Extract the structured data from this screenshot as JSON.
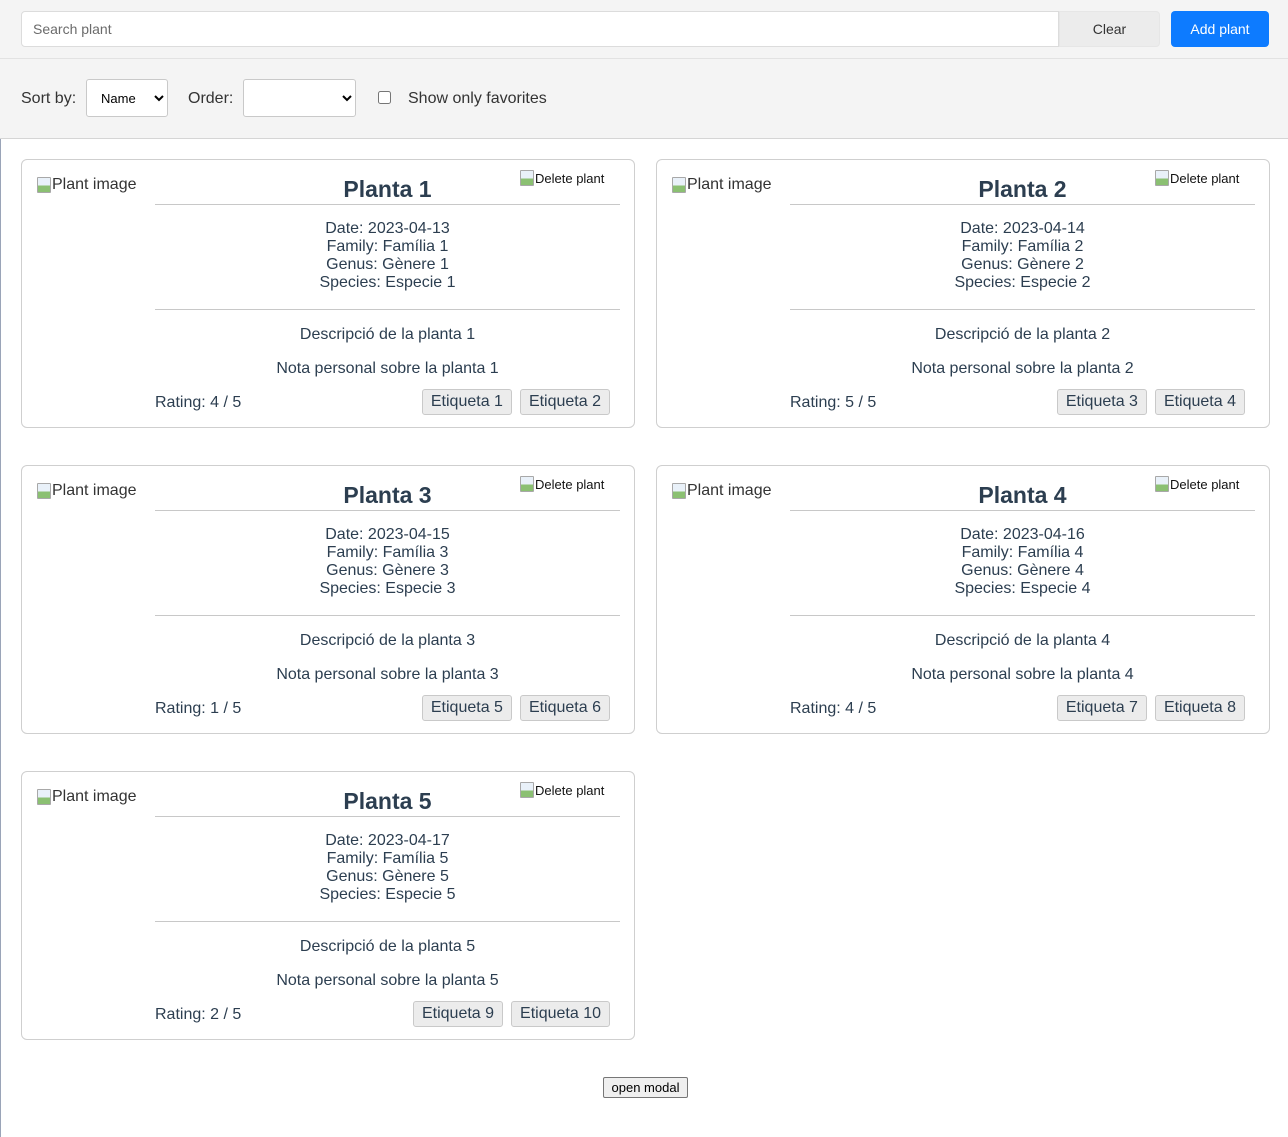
{
  "search": {
    "placeholder": "Search plant",
    "value": "",
    "clear_label": "Clear",
    "add_label": "Add plant"
  },
  "filters": {
    "sort_label": "Sort by:",
    "sort_value": "Name",
    "order_label": "Order:",
    "order_value": "",
    "favorites_label": "Show only favorites",
    "favorites_checked": false
  },
  "card_labels": {
    "image_alt": "Plant image",
    "delete_alt": "Delete plant",
    "date_prefix": "Date: ",
    "family_prefix": "Family: ",
    "genus_prefix": "Genus: ",
    "species_prefix": "Species: ",
    "rating_prefix": "Rating: ",
    "rating_suffix": " / 5"
  },
  "plants": [
    {
      "name": "Planta 1",
      "date": "2023-04-13",
      "family": "Família 1",
      "genus": "Gènere 1",
      "species": "Especie 1",
      "description": "Descripció de la planta 1",
      "note": "Nota personal sobre la planta 1",
      "rating": "4",
      "tags": [
        "Etiqueta 1",
        "Etiqueta 2"
      ]
    },
    {
      "name": "Planta 2",
      "date": "2023-04-14",
      "family": "Família 2",
      "genus": "Gènere 2",
      "species": "Especie 2",
      "description": "Descripció de la planta 2",
      "note": "Nota personal sobre la planta 2",
      "rating": "5",
      "tags": [
        "Etiqueta 3",
        "Etiqueta 4"
      ]
    },
    {
      "name": "Planta 3",
      "date": "2023-04-15",
      "family": "Família 3",
      "genus": "Gènere 3",
      "species": "Especie 3",
      "description": "Descripció de la planta 3",
      "note": "Nota personal sobre la planta 3",
      "rating": "1",
      "tags": [
        "Etiqueta 5",
        "Etiqueta 6"
      ]
    },
    {
      "name": "Planta 4",
      "date": "2023-04-16",
      "family": "Família 4",
      "genus": "Gènere 4",
      "species": "Especie 4",
      "description": "Descripció de la planta 4",
      "note": "Nota personal sobre la planta 4",
      "rating": "4",
      "tags": [
        "Etiqueta 7",
        "Etiqueta 8"
      ]
    },
    {
      "name": "Planta 5",
      "date": "2023-04-17",
      "family": "Família 5",
      "genus": "Gènere 5",
      "species": "Especie 5",
      "description": "Descripció de la planta 5",
      "note": "Nota personal sobre la planta 5",
      "rating": "2",
      "tags": [
        "Etiqueta 9",
        "Etiqueta 10"
      ]
    }
  ],
  "modal": {
    "open_label": "open modal"
  },
  "colors": {
    "accent": "#0d7bff",
    "text": "#2c3e50",
    "toolbar_bg": "#f4f4f4"
  }
}
